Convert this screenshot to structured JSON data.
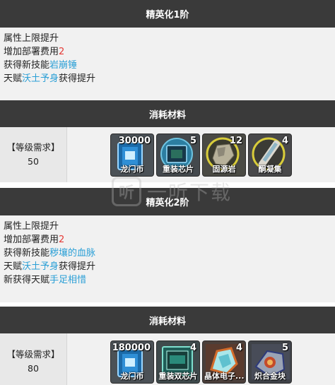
{
  "sections": [
    {
      "title": "精英化1阶",
      "lines": [
        {
          "prefix": "属性上限提升",
          "highlight": "",
          "hl_class": "",
          "suffix": ""
        },
        {
          "prefix": "增加部署费用",
          "highlight": "2",
          "hl_class": "red",
          "suffix": ""
        },
        {
          "prefix": "获得新技能",
          "highlight": "岩崩锤",
          "hl_class": "blue",
          "suffix": ""
        },
        {
          "prefix": "天赋",
          "highlight": "沃土予身",
          "hl_class": "blue",
          "suffix": "获得提升"
        }
      ],
      "materials_title": "消耗材料",
      "level_label": "【等级需求】",
      "level_value": "50",
      "items": [
        {
          "icon": "lmd-icon",
          "count": "30000",
          "name": "龙门币"
        },
        {
          "icon": "chip-icon",
          "count": "5",
          "name": "重装芯片"
        },
        {
          "icon": "stone-icon",
          "count": "12",
          "name": "固源岩"
        },
        {
          "icon": "crystal-icon",
          "count": "4",
          "name": "酮凝集"
        }
      ]
    },
    {
      "title": "精英化2阶",
      "lines": [
        {
          "prefix": "属性上限提升",
          "highlight": "",
          "hl_class": "",
          "suffix": ""
        },
        {
          "prefix": "增加部署费用",
          "highlight": "2",
          "hl_class": "red",
          "suffix": ""
        },
        {
          "prefix": "获得新技能",
          "highlight": "秽壤的血脉",
          "hl_class": "blue",
          "suffix": ""
        },
        {
          "prefix": "天赋",
          "highlight": "沃土予身",
          "hl_class": "blue",
          "suffix": "获得提升"
        },
        {
          "prefix": "新获得天赋",
          "highlight": "手足相惜",
          "hl_class": "blue",
          "suffix": ""
        }
      ],
      "materials_title": "消耗材料",
      "level_label": "【等级需求】",
      "level_value": "80",
      "items": [
        {
          "icon": "lmd-icon",
          "count": "180000",
          "name": "龙门币"
        },
        {
          "icon": "dual-chip-icon",
          "count": "4",
          "name": "重装双芯片"
        },
        {
          "icon": "crystal-circuit-icon",
          "count": "4",
          "name": "晶体电子..."
        },
        {
          "icon": "alloy-block-icon",
          "count": "5",
          "name": "炽合金块"
        }
      ]
    }
  ],
  "watermark": {
    "logo": "听",
    "text": "一听下载"
  }
}
